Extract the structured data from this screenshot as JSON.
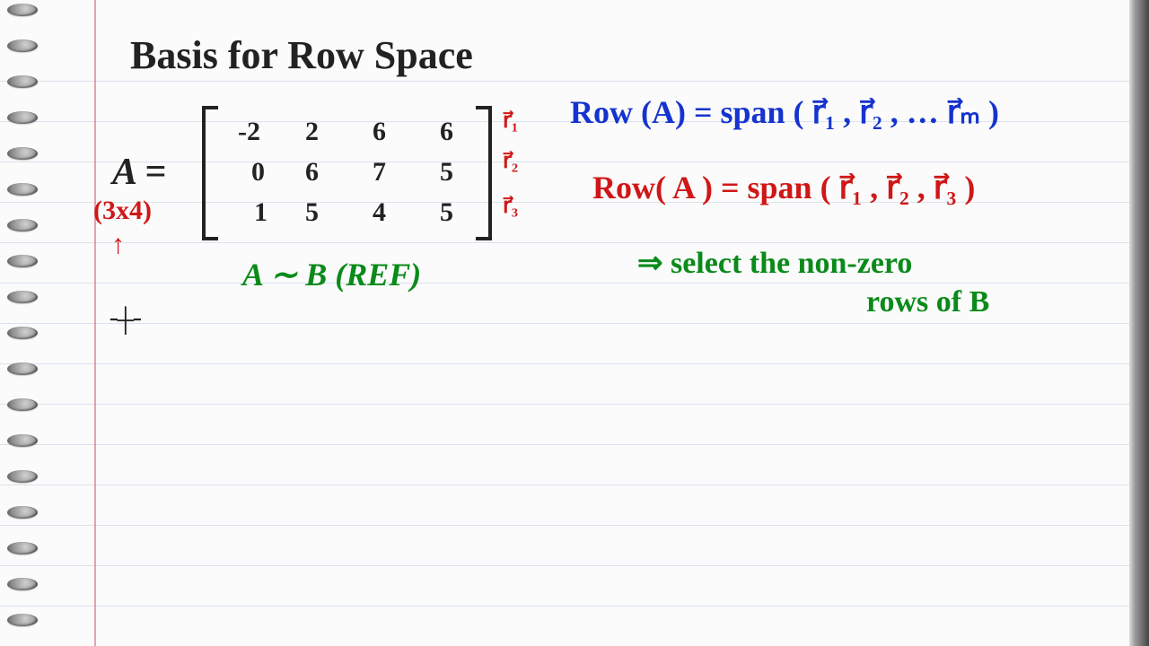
{
  "title": "Basis  for  Row  Space",
  "matrix_size": "(3x4)",
  "arrow_up": "↑",
  "matrix_rows": [
    [
      "-2",
      "2",
      "6",
      "6"
    ],
    [
      "0",
      "6",
      "7",
      "5"
    ],
    [
      "1",
      "5",
      "4",
      "5"
    ]
  ],
  "row_labels": [
    "r⃗₁",
    "r⃗₂",
    "r⃗₃"
  ],
  "A_eq": "A =",
  "blue_line": "Row (A) = span ( r⃗₁ , r⃗₂ , …  r⃗ₘ )",
  "red_line": "Row( A )  =  span ( r⃗₁ , r⃗₂ , r⃗₃ )",
  "green_l1": "A  ∼  B (REF)",
  "green_l2": "⇒  select  the  non-zero",
  "green_l3": "rows  of  B",
  "cursor": "╶┼╴"
}
